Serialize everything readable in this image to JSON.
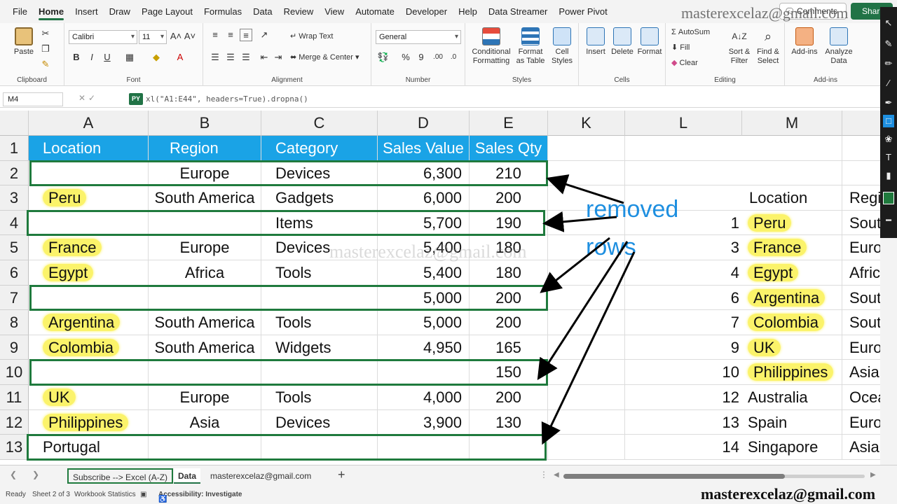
{
  "menu": {
    "tabs": [
      "File",
      "Home",
      "Insert",
      "Draw",
      "Page Layout",
      "Formulas",
      "Data",
      "Review",
      "View",
      "Automate",
      "Developer",
      "Help",
      "Data Streamer",
      "Power Pivot"
    ],
    "active": "Home",
    "comments": "Comments",
    "share": "Shar"
  },
  "ribbon": {
    "clipboard": {
      "label": "Clipboard",
      "paste": "Paste"
    },
    "font": {
      "label": "Font",
      "name": "Calibri",
      "size": "11",
      "bold": "B",
      "italic": "I",
      "underline": "U",
      "grow": "A˄",
      "shrink": "A˅"
    },
    "alignment": {
      "label": "Alignment",
      "wrap": "Wrap Text",
      "merge": "Merge & Center"
    },
    "number": {
      "label": "Number",
      "format": "General"
    },
    "styles": {
      "label": "Styles",
      "conditional": "Conditional Formatting",
      "format_table": "Format as Table",
      "cell_styles": "Cell Styles"
    },
    "cells": {
      "label": "Cells",
      "insert": "Insert",
      "delete": "Delete",
      "format": "Format"
    },
    "editing": {
      "label": "Editing",
      "autosum": "AutoSum",
      "fill": "Fill",
      "clear": "Clear",
      "sort": "Sort & Filter",
      "find": "Find & Select"
    },
    "addins": {
      "label": "Add-ins",
      "addins": "Add-ins",
      "analyze": "Analyze Data"
    }
  },
  "formula_bar": {
    "name_box": "M4",
    "badge": "PY",
    "formula": "xl(\"A1:E44\", headers=True).dropna()"
  },
  "grid": {
    "columns": [
      "A",
      "B",
      "C",
      "D",
      "E",
      "K",
      "L",
      "M"
    ],
    "row_numbers": [
      "1",
      "2",
      "3",
      "4",
      "5",
      "6",
      "7",
      "8",
      "9",
      "10",
      "11",
      "12",
      "13"
    ],
    "header": [
      "Location",
      "Region",
      "Category",
      "Sales Value",
      "Sales Qty"
    ],
    "rows": [
      [
        "",
        "Europe",
        "Devices",
        "6,300",
        "210"
      ],
      [
        "Peru",
        "South America",
        "Gadgets",
        "6,000",
        "200"
      ],
      [
        "",
        "",
        "Items",
        "5,700",
        "190"
      ],
      [
        "France",
        "Europe",
        "Devices",
        "5,400",
        "180"
      ],
      [
        "Egypt",
        "Africa",
        "Tools",
        "5,400",
        "180"
      ],
      [
        "",
        "",
        "",
        "5,000",
        "200"
      ],
      [
        "Argentina",
        "South America",
        "Tools",
        "5,000",
        "200"
      ],
      [
        "Colombia",
        "South America",
        "Widgets",
        "4,950",
        "165"
      ],
      [
        "",
        "",
        "",
        "",
        "150"
      ],
      [
        "UK",
        "Europe",
        "Tools",
        "4,000",
        "200"
      ],
      [
        "Philippines",
        "Asia",
        "Devices",
        "3,900",
        "130"
      ],
      [
        "Portugal",
        "",
        "",
        "",
        ""
      ]
    ],
    "result": {
      "header_location": "Location",
      "header_region": "Regi",
      "rows": [
        [
          "1",
          "Peru",
          "Sout"
        ],
        [
          "3",
          "France",
          "Europ"
        ],
        [
          "4",
          "Egypt",
          "Africa"
        ],
        [
          "6",
          "Argentina",
          "South"
        ],
        [
          "7",
          "Colombia",
          "South"
        ],
        [
          "9",
          "UK",
          "Europ"
        ],
        [
          "10",
          "Philippines",
          "Asia"
        ],
        [
          "12",
          "Australia",
          "Ocear"
        ],
        [
          "13",
          "Spain",
          "Europ"
        ],
        [
          "14",
          "Singapore",
          "Asia"
        ]
      ]
    }
  },
  "annotation": {
    "line1": "removed",
    "line2": "rows"
  },
  "watermarks": {
    "center": "masterexcelaz@gmail.com",
    "top": "masterexcelaz@gmail.com",
    "bottom": "masterexcelaz@gmail.com"
  },
  "sheets": {
    "tabs": [
      "Subscribe --> Excel (A-Z)",
      "Data",
      "masterexcelaz@gmail.com"
    ],
    "active": "Data"
  },
  "status": {
    "ready": "Ready",
    "sheet_of": "Sheet 2 of 3",
    "workbook_stats": "Workbook Statistics",
    "accessibility": "Accessibility: Investigate"
  },
  "colors": {
    "header_fill": "#1aa3e6",
    "highlight": "#fbf36a",
    "box_border": "#1f7a3d",
    "annotation": "#1e8fe0",
    "excel_green": "#217346"
  }
}
